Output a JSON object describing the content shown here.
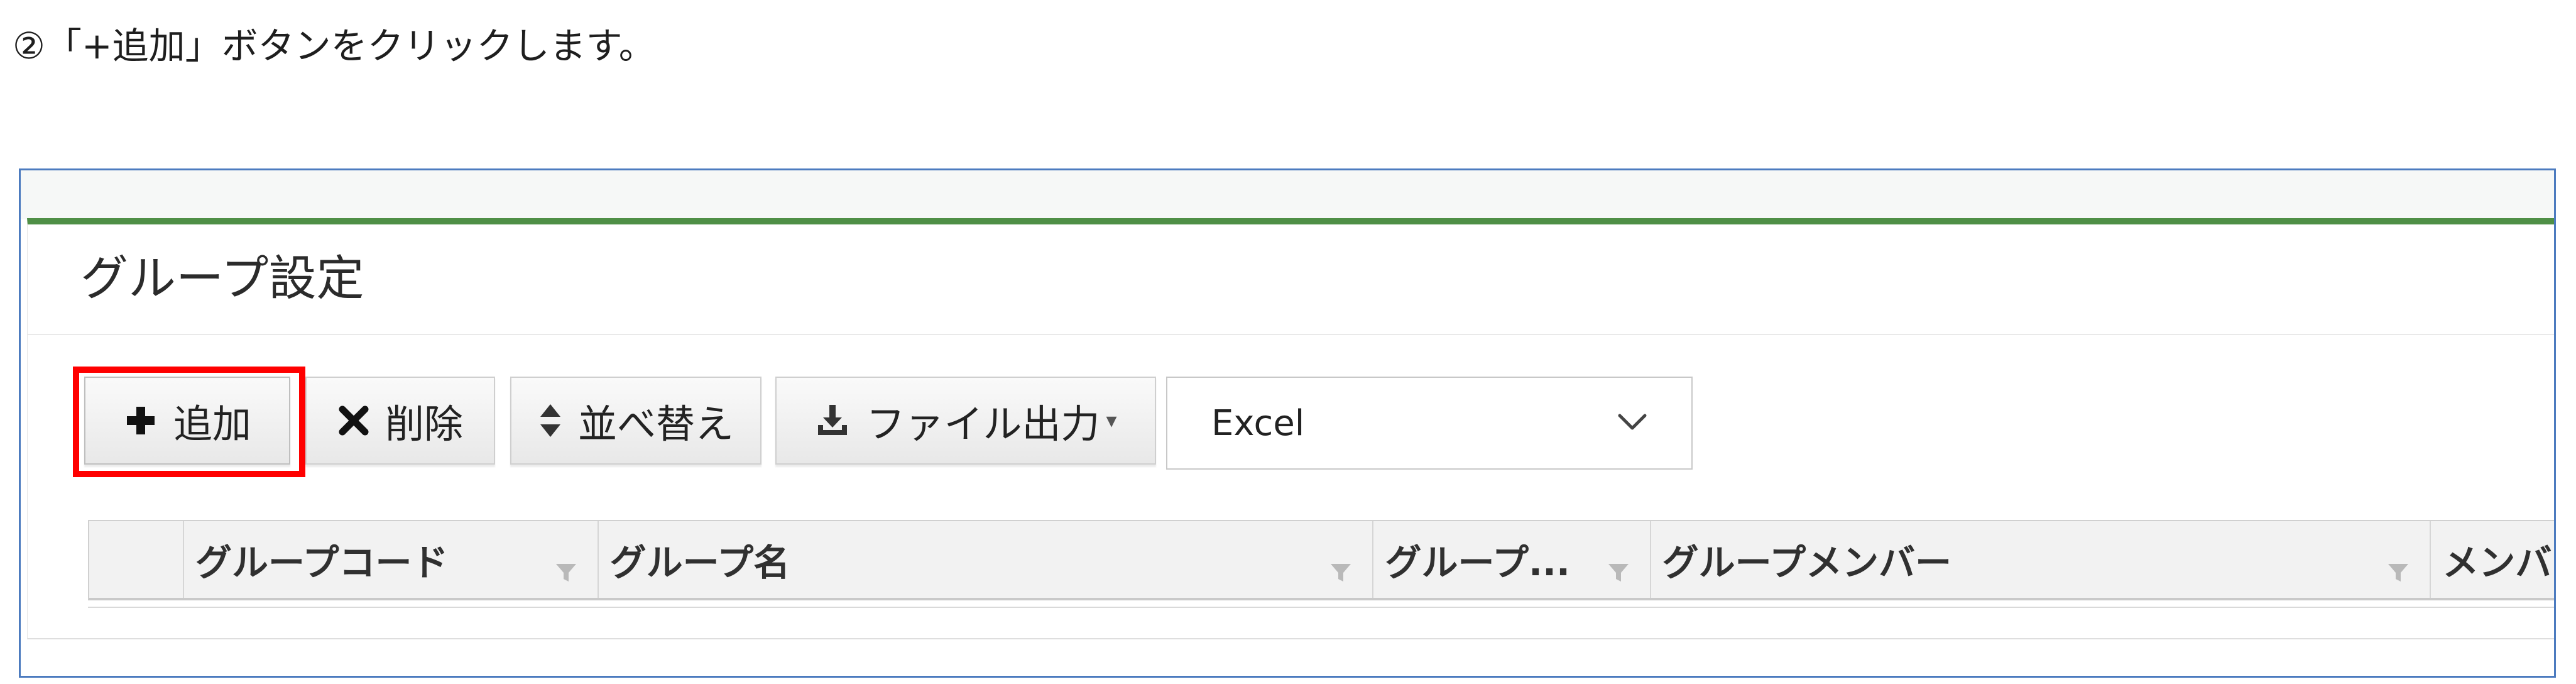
{
  "instruction": {
    "text": "②「+追加」ボタンをクリックします。"
  },
  "panel": {
    "title": "グループ設定"
  },
  "toolbar": {
    "add_label": "追加",
    "delete_label": "削除",
    "sort_label": "並べ替え",
    "export_label": "ファイル出力",
    "export_format": "Excel"
  },
  "grid": {
    "columns": [
      "グループコード",
      "グループ名",
      "グループ...",
      "グループメンバー",
      "メンバ"
    ]
  },
  "colors": {
    "accent_green": "#4f8f46",
    "highlight_red": "#ff0000",
    "frame_blue": "#4c7bbf"
  },
  "icons": {
    "add": "plus-icon",
    "delete": "x-icon",
    "sort": "sort-icon",
    "export": "download-icon",
    "select": "chevron-down-icon",
    "filter": "filter-icon"
  }
}
